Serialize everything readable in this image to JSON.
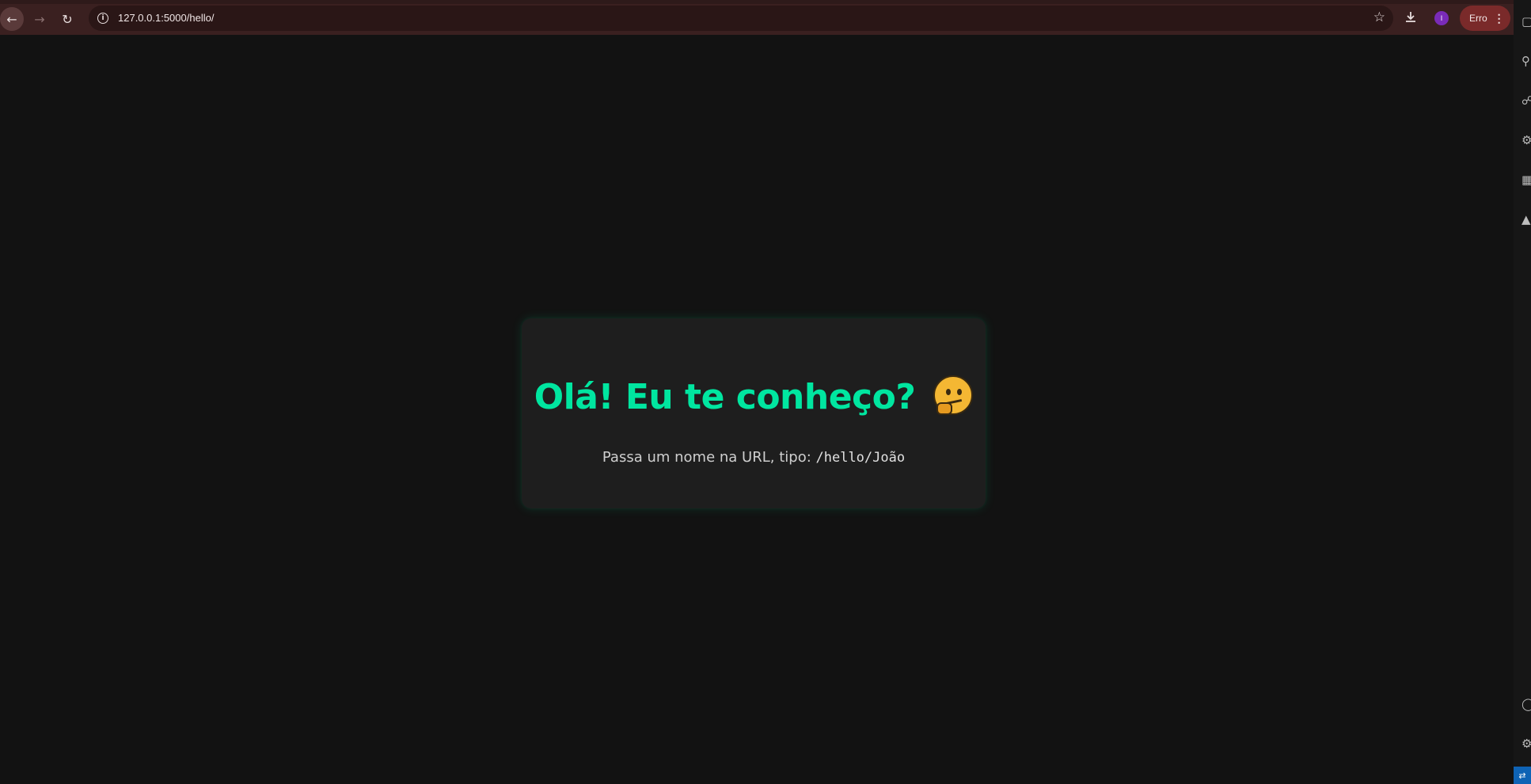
{
  "browser": {
    "url": "127.0.0.1:5000/hello/",
    "profile_initial": "I",
    "error_label": "Erro"
  },
  "page": {
    "heading": "Olá! Eu te conheço?",
    "emoji_name": "thinking-face",
    "hint_text": "Passa um nome na URL, tipo: ",
    "hint_code": "/hello/João",
    "accent_color": "#00e6a0"
  }
}
